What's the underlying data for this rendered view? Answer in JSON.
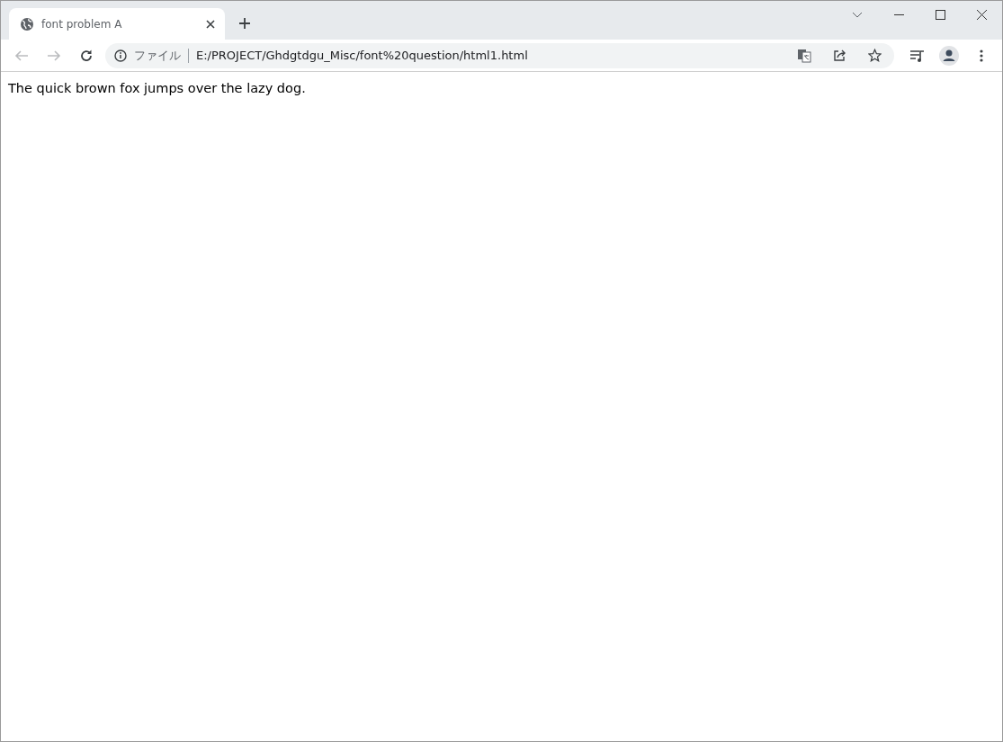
{
  "tabs": [
    {
      "title": "font problem A",
      "selected": true
    }
  ],
  "toolbar": {
    "back_disabled": true,
    "forward_disabled": true
  },
  "address_bar": {
    "scheme_label": "ファイル",
    "url": "E:/PROJECT/Ghdgtdgu_Misc/font%20question/html1.html"
  },
  "page": {
    "text": "The quick brown fox jumps over the lazy dog."
  }
}
